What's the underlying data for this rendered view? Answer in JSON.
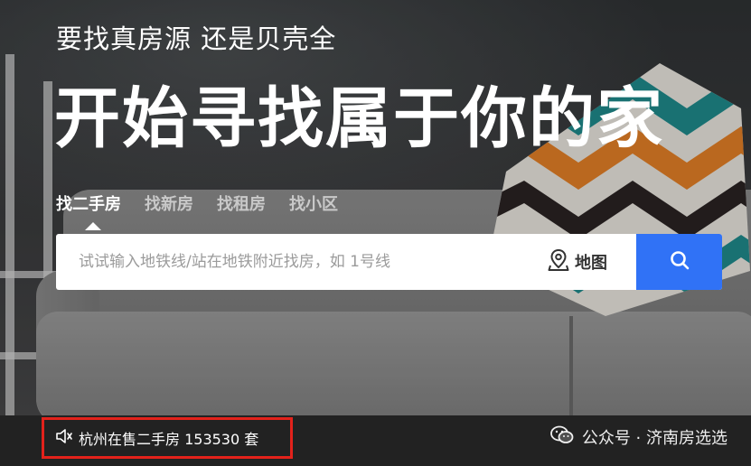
{
  "hero": {
    "subtitle": "要找真房源 还是贝壳全",
    "headline": "开始寻找属于你的家"
  },
  "tabs": [
    {
      "label": "找二手房",
      "active": true
    },
    {
      "label": "找新房",
      "active": false
    },
    {
      "label": "找租房",
      "active": false
    },
    {
      "label": "找小区",
      "active": false
    }
  ],
  "search": {
    "placeholder": "试试输入地铁线/站在地铁附近找房，如 1号线",
    "value": "",
    "map_label": "地图",
    "map_icon": "location-pin-icon",
    "button_icon": "search-icon",
    "button_color": "#3072f6"
  },
  "notice": {
    "icon": "speaker-icon",
    "text": "杭州在售二手房 153530 套",
    "highlight_border_color": "#e3221b"
  },
  "watermark": {
    "icon": "wechat-icon",
    "text": "公众号 · 济南房选选"
  }
}
